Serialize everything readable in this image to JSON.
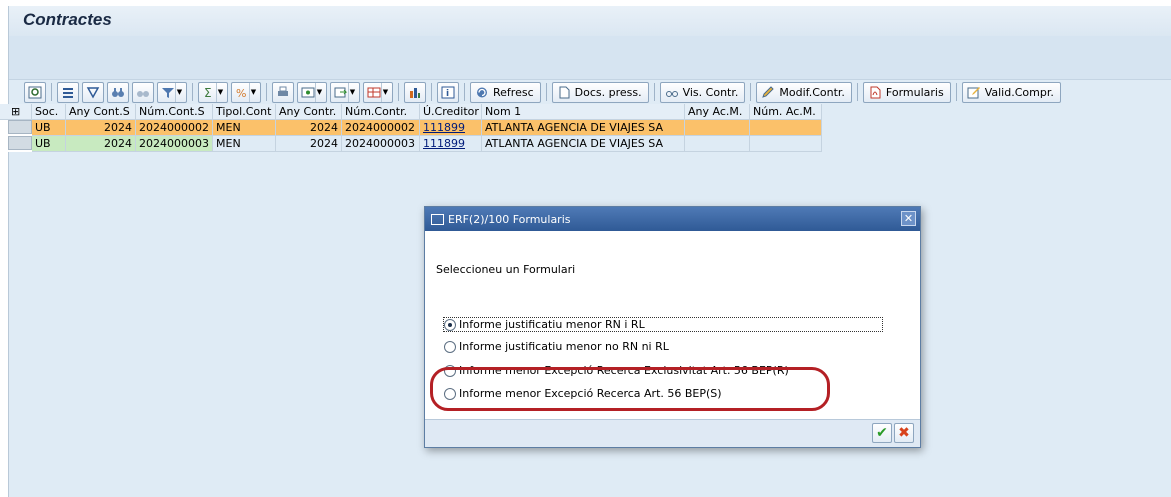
{
  "window": {
    "title": "Contractes"
  },
  "toolbar": {
    "refresh_label": "Refresc",
    "docs_label": "Docs. press.",
    "view_label": "Vis. Contr.",
    "modify_label": "Modif.Contr.",
    "forms_label": "Formularis",
    "validate_label": "Valid.Compr."
  },
  "table": {
    "headers": [
      "Soc.",
      "Any Cont.S",
      "Núm.Cont.S",
      "Tipol.Cont",
      "Any Contr.",
      "Núm.Contr.",
      "Ú.Creditor",
      "Nom 1",
      "Any Ac.M.",
      "Núm. Ac.M."
    ],
    "rows": [
      {
        "soc": "UB",
        "any_cont_s": "2024",
        "num_cont_s": "2024000002",
        "tipol": "MEN",
        "any_contr": "2024",
        "num_contr": "2024000002",
        "creditor": "111899",
        "nom": "ATLANTA AGENCIA DE VIAJES SA",
        "any_acm": "",
        "num_acm": ""
      },
      {
        "soc": "UB",
        "any_cont_s": "2024",
        "num_cont_s": "2024000003",
        "tipol": "MEN",
        "any_contr": "2024",
        "num_contr": "2024000003",
        "creditor": "111899",
        "nom": "ATLANTA AGENCIA DE VIAJES SA",
        "any_acm": "",
        "num_acm": ""
      }
    ]
  },
  "dialog": {
    "title": "ERF(2)/100 Formularis",
    "prompt": "Seleccioneu un Formulari",
    "options": [
      {
        "label": "Informe justificatiu menor RN i RL",
        "selected": true
      },
      {
        "label": "Informe justificatiu menor no RN ni RL",
        "selected": false
      },
      {
        "label": "Informe menor Excepció Recerca Exclusivitat Art. 56 BEP(R)",
        "selected": false
      },
      {
        "label": "Informe menor Excepció Recerca Art. 56 BEP(S)",
        "selected": false
      }
    ]
  },
  "colors": {
    "selected_row": "#fbc16a",
    "key_column": "#c8eac0",
    "highlight_ring": "#b42025",
    "dialog_title": "#2f5a96"
  }
}
